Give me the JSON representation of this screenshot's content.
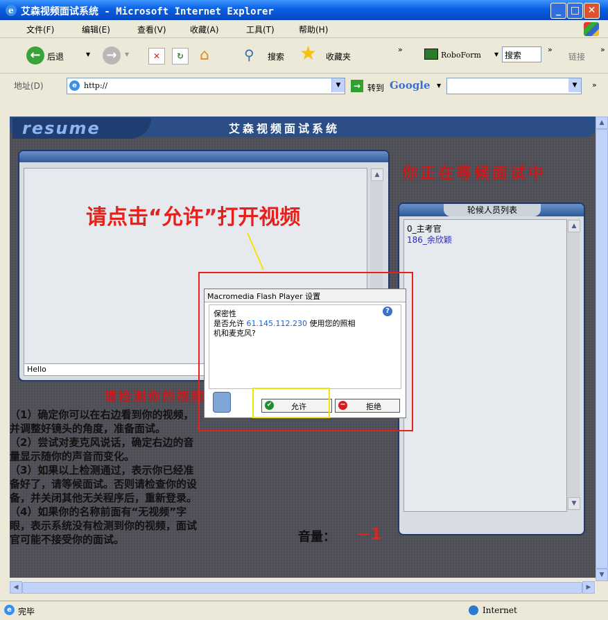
{
  "window": {
    "title": "艾森视频面试系统 - Microsoft Internet Explorer"
  },
  "menu": [
    "文件(F)",
    "编辑(E)",
    "查看(V)",
    "收藏(A)",
    "工具(T)",
    "帮助(H)"
  ],
  "toolbar": {
    "back": "后退",
    "search": "搜索",
    "favorites": "收藏夹",
    "roboform": "RoboForm",
    "roboform_search": "搜索",
    "links": "链接"
  },
  "address": {
    "label": "地址(D)",
    "url": "http://",
    "go": "转到",
    "google": "Google"
  },
  "app": {
    "logo": "resume",
    "title": "艾森视频面试系统",
    "waiting": "你正在等候面试中",
    "prompt": "请点击“允许”打开视频",
    "video_label": "Hello",
    "queue_title": "轮候人员列表",
    "queue": [
      "0_主考官",
      "186_余欣颖"
    ],
    "check_title": "请检测你的视频",
    "instructions": [
      "（1）确定你可以在右边看到你的视频，",
      "并调整好镜头的角度，准备面试。",
      "（2）尝试对麦克风说话，确定右边的音",
      "量显示随你的声音而变化。",
      "（3）如果以上检测通过，表示你已经准",
      "备好了，请等候面试。否则请检查你的设",
      "备，并关闭其他无关程序后，重新登录。",
      "（4）如果你的名称前面有“无视频”字",
      "眼，表示系统没有检测到你的视频，面试",
      "官可能不接受你的面试。"
    ],
    "volume_label": "音量：",
    "volume_value": "−1"
  },
  "dialog": {
    "title": "Macromedia Flash Player 设置",
    "section": "保密性",
    "msg_prefix": "是否允许",
    "ip": "61.145.112.230",
    "msg_suffix": " 使用您的照相",
    "msg_line2": "机和麦克风?",
    "allow": "允许",
    "deny": "拒绝"
  },
  "status": {
    "text": "完毕",
    "zone": "Internet"
  },
  "colors": {
    "accent_red": "#e6201b",
    "highlight_yellow": "#f2e600",
    "ip_blue": "#1a63c8"
  }
}
